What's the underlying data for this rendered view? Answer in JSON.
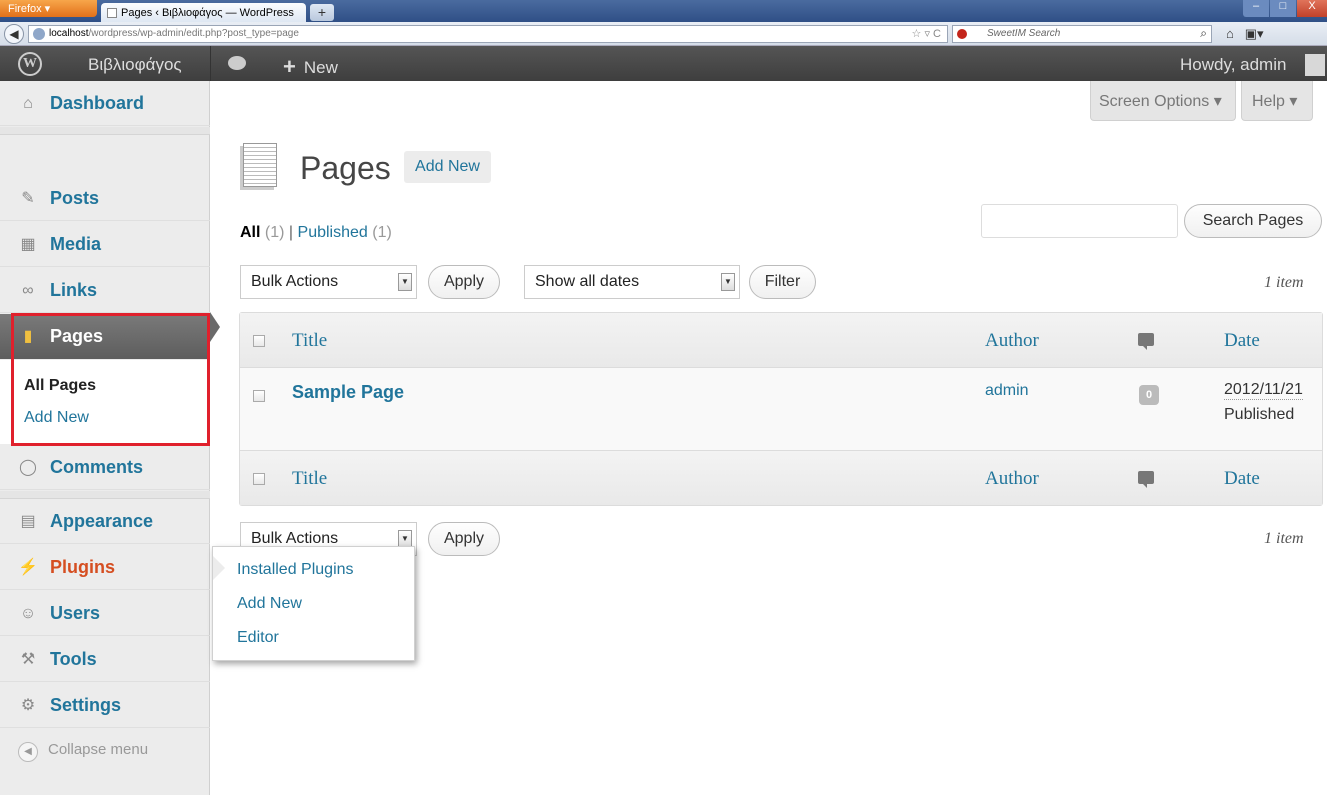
{
  "browser": {
    "app_button": "Firefox",
    "tab_title": "Pages ‹ Βιβλιοφάγος — WordPress",
    "new_tab": "+",
    "url_host": "localhost",
    "url_path": "/wordpress/wp-admin/edit.php?post_type=page",
    "search_placeholder": "SweetIM Search",
    "window_controls": {
      "minimize": "–",
      "maximize": "□",
      "close": "X"
    }
  },
  "adminbar": {
    "site_name": "Βιβλιοφάγος",
    "new_label": "New",
    "howdy": "Howdy, admin"
  },
  "sidebar": {
    "items": [
      {
        "label": "Dashboard",
        "icon": "home-icon"
      },
      {
        "label": "Posts",
        "icon": "pin-icon"
      },
      {
        "label": "Media",
        "icon": "media-icon"
      },
      {
        "label": "Links",
        "icon": "link-icon"
      },
      {
        "label": "Pages",
        "icon": "pages-icon"
      },
      {
        "label": "Comments",
        "icon": "comment-icon"
      },
      {
        "label": "Appearance",
        "icon": "appearance-icon"
      },
      {
        "label": "Plugins",
        "icon": "plugin-icon"
      },
      {
        "label": "Users",
        "icon": "users-icon"
      },
      {
        "label": "Tools",
        "icon": "tools-icon"
      },
      {
        "label": "Settings",
        "icon": "settings-icon"
      }
    ],
    "pages_submenu": [
      "All Pages",
      "Add New"
    ],
    "collapse_label": "Collapse menu"
  },
  "plugins_flyout": [
    "Installed Plugins",
    "Add New",
    "Editor"
  ],
  "header": {
    "title": "Pages",
    "add_new": "Add New",
    "screen_options": "Screen Options ▾",
    "help": "Help ▾"
  },
  "filters": {
    "all_label": "All",
    "all_count": "(1)",
    "separator": "|",
    "published_label": "Published",
    "published_count": "(1)",
    "search_button": "Search Pages",
    "bulk_actions": "Bulk Actions",
    "apply": "Apply",
    "dates": "Show all dates",
    "filter": "Filter",
    "item_count": "1 item"
  },
  "table": {
    "columns": {
      "title": "Title",
      "author": "Author",
      "date": "Date"
    },
    "rows": [
      {
        "title": "Sample Page",
        "author": "admin",
        "comments": "0",
        "date": "2012/11/21",
        "status": "Published"
      }
    ]
  }
}
